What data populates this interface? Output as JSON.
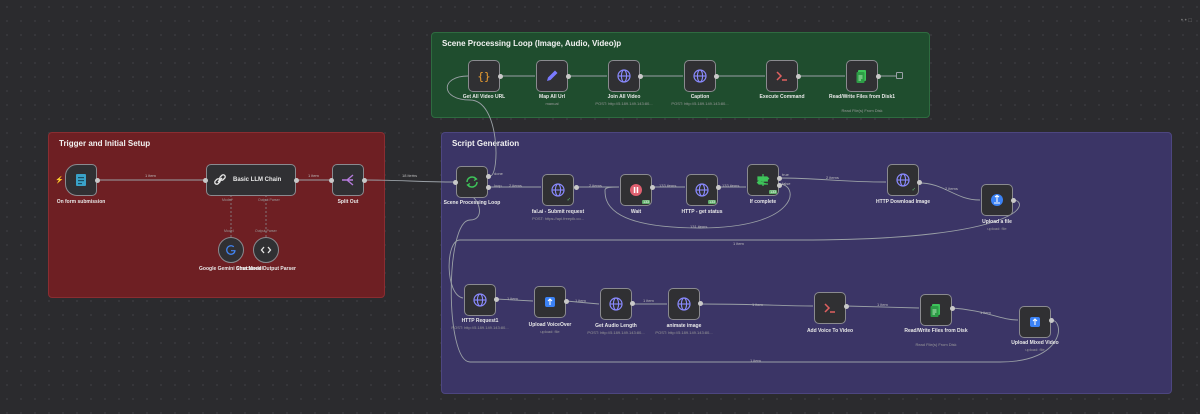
{
  "sticky_notes": [
    {
      "title": "Scene Processing Loop (Image, Audio, Video)p",
      "color": "#1f4d2e",
      "border": "#2e6b40"
    },
    {
      "title": "Trigger and Initial Setup",
      "color": "#6e1f23",
      "border": "#8a2d31"
    },
    {
      "title": "Script Generation",
      "color": "#3b3566",
      "border": "#4d4680"
    }
  ],
  "top_right_controls": "• • □",
  "nodes": [
    {
      "id": "form",
      "label": "On form submission",
      "sub": "",
      "icon": "form-icon",
      "color": "#3aa3c9"
    },
    {
      "id": "llm",
      "label": "Basic LLM Chain",
      "sub": "",
      "icon": "link-icon",
      "color": "#e8e8e8"
    },
    {
      "id": "gemini",
      "label": "Google Gemini Chat Model",
      "sub": "",
      "icon": "google-icon",
      "color": "#4285f4"
    },
    {
      "id": "parser",
      "label": "Structured Output Parser",
      "sub": "",
      "icon": "code-icon",
      "color": "#e8e8e8"
    },
    {
      "id": "split",
      "label": "Split Out",
      "sub": "",
      "icon": "split-icon",
      "color": "#b57bdb"
    },
    {
      "id": "getall",
      "label": "Get All Video URL",
      "sub": "",
      "icon": "braces-icon",
      "color": "#f0a030"
    },
    {
      "id": "map",
      "label": "Map All Url",
      "sub": "manual",
      "icon": "pen-icon",
      "color": "#7a7aff"
    },
    {
      "id": "join",
      "label": "Join All Video",
      "sub": "POST: http://5.189.149.143:80...",
      "icon": "globe-icon",
      "color": "#8a8aff"
    },
    {
      "id": "caption",
      "label": "Caption",
      "sub": "POST: http://5.189.149.143:80...",
      "icon": "globe-icon",
      "color": "#8a8aff"
    },
    {
      "id": "exec",
      "label": "Execute Command",
      "sub": "",
      "icon": "terminal-icon",
      "color": "#e06060"
    },
    {
      "id": "rw1",
      "label": "Read/Write Files from Disk1",
      "sub": "Read File(s) From Disk",
      "icon": "files-icon",
      "color": "#3ec45a"
    },
    {
      "id": "loop",
      "label": "Scene Processing Loop",
      "sub": "",
      "icon": "loop-icon",
      "color": "#3ec45a"
    },
    {
      "id": "falai",
      "label": "fal.ai - Submit request",
      "sub": "POST: https://api.freepik.co...",
      "icon": "globe-icon",
      "color": "#8a8aff"
    },
    {
      "id": "wait",
      "label": "Wait",
      "sub": "",
      "icon": "pause-icon",
      "color": "#e06070"
    },
    {
      "id": "getstatus",
      "label": "HTTP - get status",
      "sub": "",
      "icon": "globe-icon",
      "color": "#8a8aff"
    },
    {
      "id": "ifcomplete",
      "label": "If complete",
      "sub": "",
      "icon": "if-icon",
      "color": "#3ec45a"
    },
    {
      "id": "download",
      "label": "HTTP Download Image",
      "sub": "",
      "icon": "globe-icon",
      "color": "#8a8aff"
    },
    {
      "id": "upload1",
      "label": "Upload a file",
      "sub": "upload: file",
      "icon": "drive-icon",
      "color": "#3b82f6"
    },
    {
      "id": "http1",
      "label": "HTTP Request1",
      "sub": "POST: http://5.189.149.143:80...",
      "icon": "globe-icon",
      "color": "#8a8aff"
    },
    {
      "id": "uploadvo",
      "label": "Upload VoiceOver",
      "sub": "upload: file",
      "icon": "drive-icon",
      "color": "#3b82f6"
    },
    {
      "id": "audiolen",
      "label": "Get Audio Length",
      "sub": "POST: http://5.189.149.143:80...",
      "icon": "globe-icon",
      "color": "#8a8aff"
    },
    {
      "id": "animate",
      "label": "animate image",
      "sub": "POST: http://5.189.149.143:80...",
      "icon": "globe-icon",
      "color": "#8a8aff"
    },
    {
      "id": "addvoice",
      "label": "Add Voice To Video",
      "sub": "",
      "icon": "terminal-icon",
      "color": "#e06060"
    },
    {
      "id": "rw2",
      "label": "Read/Write Files from Disk",
      "sub": "Read File(s) From Disk",
      "icon": "files-icon",
      "color": "#3ec45a"
    },
    {
      "id": "uploadmix",
      "label": "Upload Mixed Video",
      "sub": "upload: file",
      "icon": "drive-icon",
      "color": "#3b82f6"
    }
  ],
  "edge_labels": {
    "form_llm": "1 item",
    "llm_split": "1 item",
    "split_loop": "18 items",
    "loop_done": "done",
    "loop_loop": "loop",
    "loop_falai": "2 items",
    "falai_wait": "2 items",
    "wait_status": "133 items",
    "status_if": "133 items",
    "if_true": "true",
    "if_false": "false",
    "false_back": "131 items",
    "if_download": "2 items",
    "download_upload": "2 items",
    "upload_http1": "1 item",
    "http1_vo": "1 item",
    "vo_audio": "1 item",
    "audio_animate": "1 item",
    "animate_addvoice": "1 item",
    "addvoice_rw2": "1 item",
    "rw2_mix": "1 item",
    "mix_back": "1 item"
  },
  "dep_labels": {
    "model": "Model*",
    "output_parser": "Output Parser",
    "model_small": "Model",
    "parser_small": "Output Parser"
  },
  "badges": {
    "wait": "133",
    "getstatus": "133",
    "ifcomplete": "133"
  }
}
